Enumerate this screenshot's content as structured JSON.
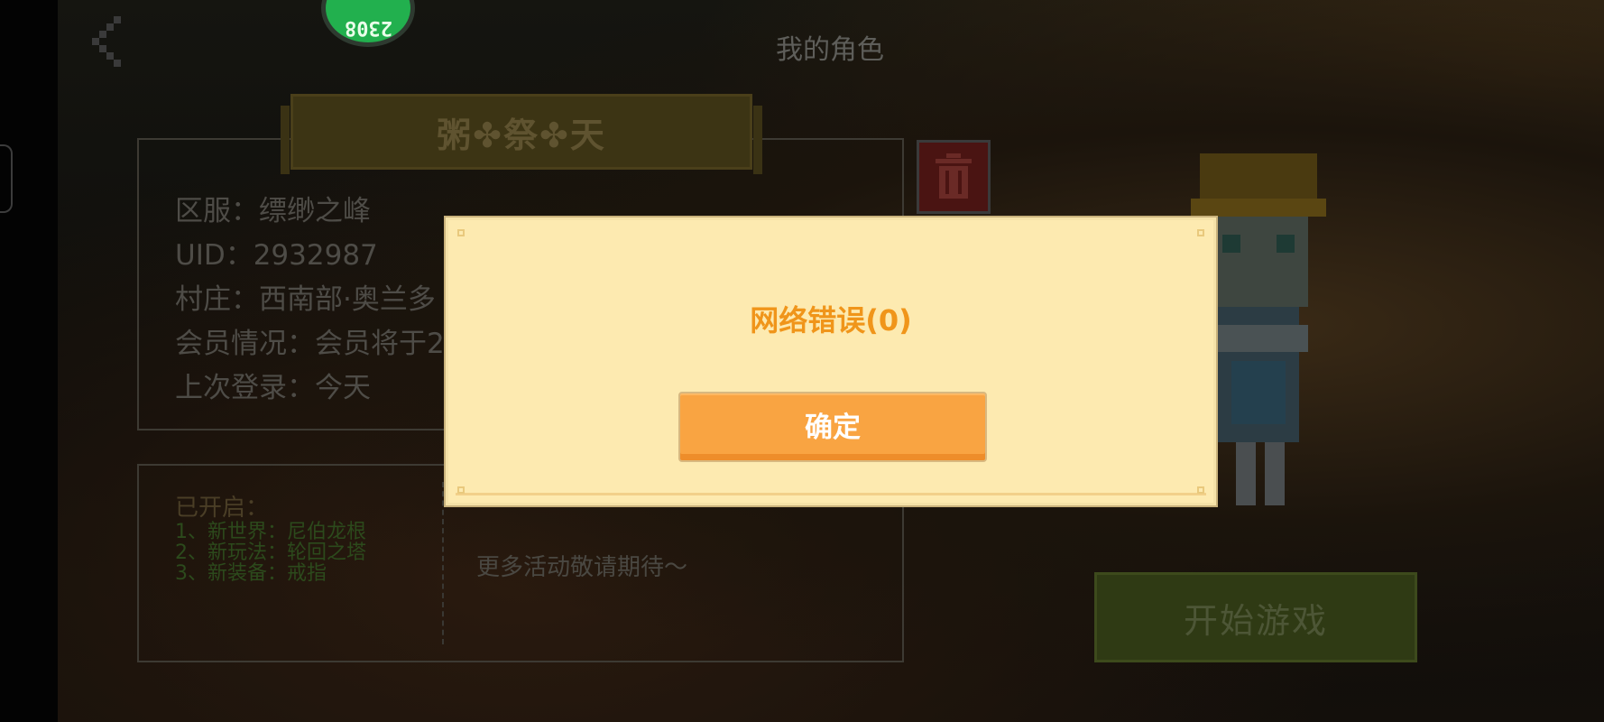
{
  "header": {
    "title": "我的角色",
    "avatar_badge": "2308"
  },
  "role": {
    "name": "粥✤祭✤天",
    "info": [
      "区服：缥缈之峰",
      "UID：2932987",
      "村庄：西南部·奥兰多",
      "会员情况：会员将于2",
      "上次登录：今天"
    ]
  },
  "news": {
    "opened_title": "已开启：",
    "opened_items": [
      "1、新世界：尼伯龙根",
      "2、新玩法：轮回之塔",
      "3、新装备：戒指"
    ],
    "more_text": "更多活动敬请期待～"
  },
  "start_button": {
    "label": "开始游戏"
  },
  "dialog": {
    "message": "网络错误(0)",
    "confirm_label": "确定"
  },
  "colors": {
    "dialog_bg": "#fdeab0",
    "dialog_text": "#f0951a",
    "confirm_button": "#f9a442",
    "delete_button": "#4a1412",
    "start_button": "#2f3a14"
  },
  "icons": {
    "back": "back-arrow-icon",
    "delete": "trash-icon"
  }
}
